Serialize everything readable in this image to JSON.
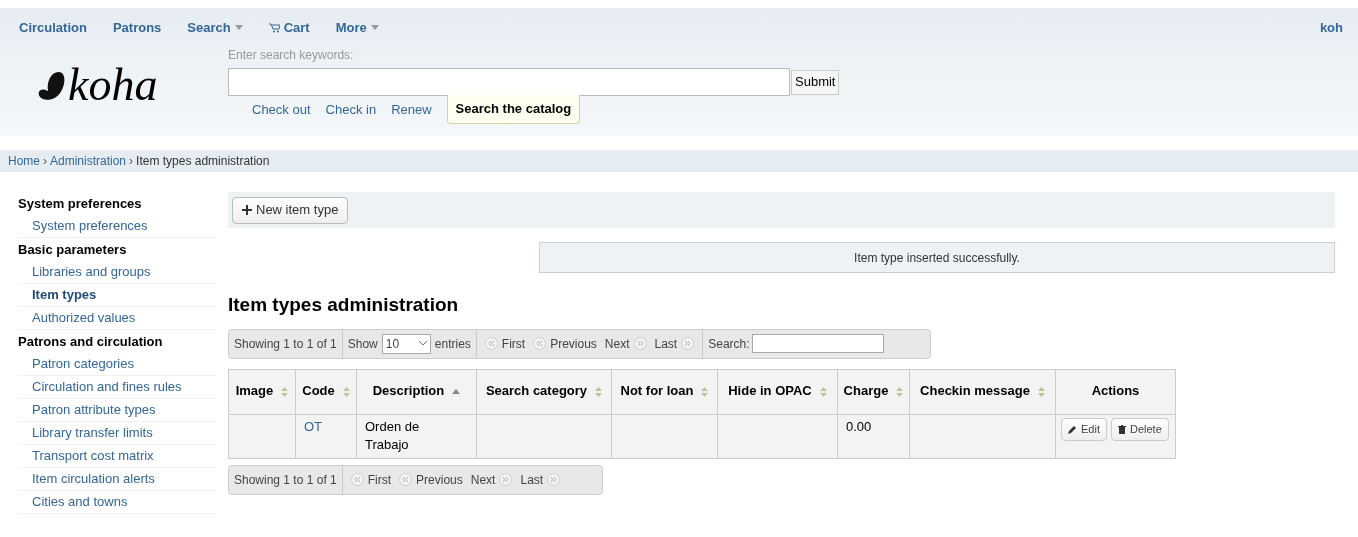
{
  "nav": {
    "items": [
      {
        "label": "Circulation",
        "kind": "link"
      },
      {
        "label": "Patrons",
        "kind": "link"
      },
      {
        "label": "Search",
        "kind": "dropdown"
      },
      {
        "label": "Cart",
        "kind": "cart"
      },
      {
        "label": "More",
        "kind": "dropdown"
      }
    ],
    "user": "koh"
  },
  "logo": {
    "text": "koha"
  },
  "search": {
    "label": "Enter search keywords:",
    "submit": "Submit",
    "tabs": [
      {
        "label": "Check out",
        "selected": false
      },
      {
        "label": "Check in",
        "selected": false
      },
      {
        "label": "Renew",
        "selected": false
      },
      {
        "label": "Search the catalog",
        "selected": true
      }
    ]
  },
  "breadcrumb": {
    "separator": "›",
    "links": [
      "Home",
      "Administration"
    ],
    "current": "Item types administration"
  },
  "sidebar": [
    {
      "heading": "System preferences",
      "items": [
        {
          "label": "System preferences",
          "selected": false
        }
      ]
    },
    {
      "heading": "Basic parameters",
      "items": [
        {
          "label": "Libraries and groups",
          "selected": false
        },
        {
          "label": "Item types",
          "selected": true
        },
        {
          "label": "Authorized values",
          "selected": false
        }
      ]
    },
    {
      "heading": "Patrons and circulation",
      "items": [
        {
          "label": "Patron categories",
          "selected": false
        },
        {
          "label": "Circulation and fines rules",
          "selected": false
        },
        {
          "label": "Patron attribute types",
          "selected": false
        },
        {
          "label": "Library transfer limits",
          "selected": false
        },
        {
          "label": "Transport cost matrix",
          "selected": false
        },
        {
          "label": "Item circulation alerts",
          "selected": false
        },
        {
          "label": "Cities and towns",
          "selected": false
        }
      ]
    }
  ],
  "toolbar": {
    "button": "New item type"
  },
  "message": "Item type inserted successfully.",
  "page_title": "Item types administration",
  "table_top": {
    "info": "Showing 1 to 1 of 1",
    "show": "Show",
    "length": "10",
    "entries": "entries",
    "pager": [
      "First",
      "Previous",
      "Next",
      "Last"
    ],
    "search_label": "Search:"
  },
  "table": {
    "columns": [
      {
        "label": "Image",
        "sortable": true,
        "sorted_ascending": false
      },
      {
        "label": "Code",
        "sortable": true,
        "sorted_ascending": false
      },
      {
        "label": "Description",
        "sortable": true,
        "sorted_ascending": true
      },
      {
        "label": "Search category",
        "sortable": true,
        "sorted_ascending": false
      },
      {
        "label": "Not for loan",
        "sortable": true,
        "sorted_ascending": false
      },
      {
        "label": "Hide in OPAC",
        "sortable": true,
        "sorted_ascending": false
      },
      {
        "label": "Charge",
        "sortable": true,
        "sorted_ascending": false
      },
      {
        "label": "Checkin message",
        "sortable": true,
        "sorted_ascending": false
      },
      {
        "label": "Actions",
        "sortable": false,
        "sorted_ascending": false
      }
    ],
    "rows": [
      {
        "image": "",
        "code": "OT",
        "description": "Orden de Trabajo",
        "search_category": "",
        "not_for_loan": "",
        "hide_in_opac": "",
        "charge": "0.00",
        "checkin_message": "",
        "actions": [
          "Edit",
          "Delete"
        ]
      }
    ]
  },
  "table_bottom": {
    "info": "Showing 1 to 1 of 1",
    "pager": [
      "First",
      "Previous",
      "Next",
      "Last"
    ]
  }
}
